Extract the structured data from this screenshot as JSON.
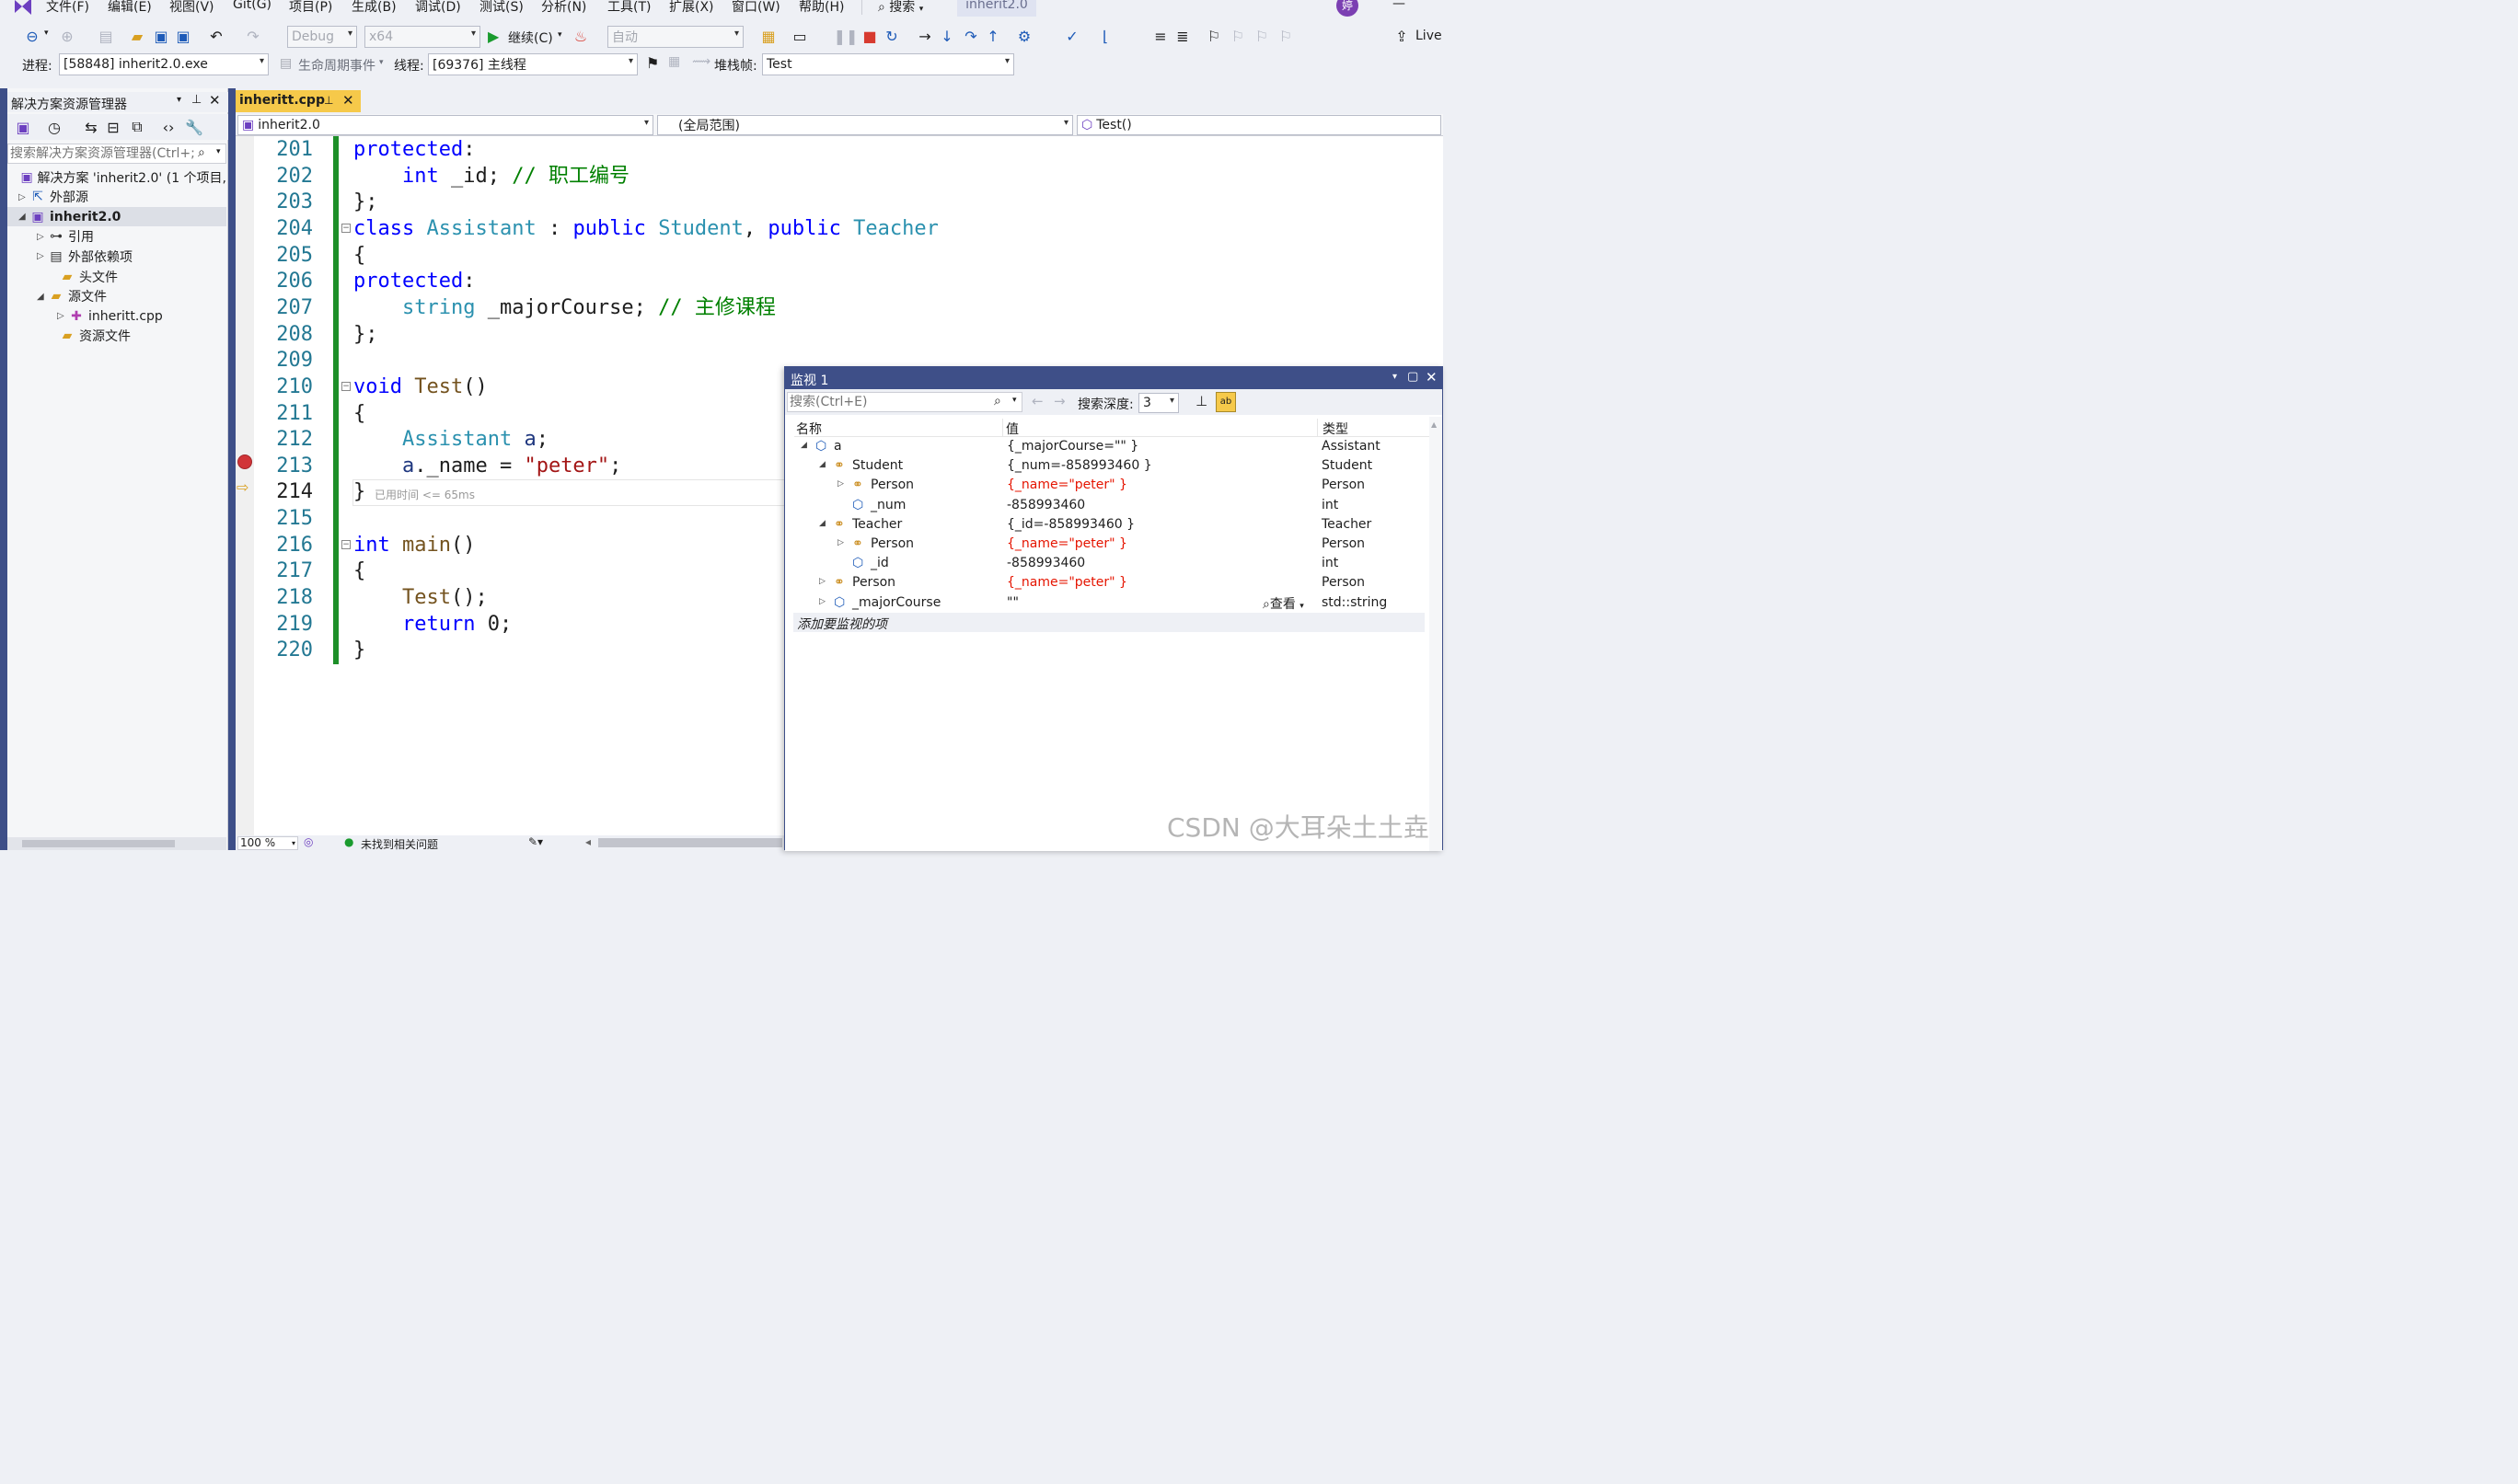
{
  "menu": {
    "items": [
      "文件(F)",
      "编辑(E)",
      "视图(V)",
      "Git(G)",
      "项目(P)",
      "生成(B)",
      "调试(D)",
      "测试(S)",
      "分析(N)",
      "工具(T)",
      "扩展(X)",
      "窗口(W)",
      "帮助(H)"
    ],
    "search": "搜索",
    "solution_tab": "inherit2.0",
    "avatar": "婷"
  },
  "toolbar": {
    "config": "Debug",
    "platform": "x64",
    "continue": "继续(C)",
    "auto": "自动",
    "live": "Live"
  },
  "debugbar": {
    "process_label": "进程:",
    "process": "[58848] inherit2.0.exe",
    "lifecycle": "生命周期事件",
    "thread_label": "线程:",
    "thread": "[69376] 主线程",
    "stack_label": "堆栈帧:",
    "stack": "Test"
  },
  "solution_explorer": {
    "title": "解决方案资源管理器",
    "search_placeholder": "搜索解决方案资源管理器(Ctrl+;)",
    "items": [
      {
        "label": "解决方案 'inherit2.0' (1 个项目,",
        "icon": "solution-icon",
        "tri": ""
      },
      {
        "label": "外部源",
        "icon": "external-source-icon",
        "tri": "▷"
      },
      {
        "label": "inherit2.0",
        "icon": "project-icon",
        "tri": "◢"
      },
      {
        "label": "引用",
        "icon": "references-icon",
        "tri": "▷"
      },
      {
        "label": "外部依赖项",
        "icon": "external-deps-icon",
        "tri": "▷"
      },
      {
        "label": "头文件",
        "icon": "folder-icon",
        "tri": ""
      },
      {
        "label": "源文件",
        "icon": "folder-icon",
        "tri": "◢"
      },
      {
        "label": "inheritt.cpp",
        "icon": "cpp-file-icon",
        "tri": "▷"
      },
      {
        "label": "资源文件",
        "icon": "folder-icon",
        "tri": ""
      }
    ]
  },
  "editor": {
    "tab": "inheritt.cpp",
    "nav_project": "inherit2.0",
    "nav_scope": "(全局范围)",
    "nav_func": "Test()",
    "elapsed": "已用时间 <= 65ms",
    "zoom": "100 %",
    "status": "未找到相关问题",
    "lines": [
      {
        "n": "201",
        "segs": [
          [
            "kw",
            "protected"
          ],
          [
            "pl",
            ":"
          ]
        ]
      },
      {
        "n": "202",
        "segs": [
          [
            "pl",
            "    "
          ],
          [
            "kw",
            "int"
          ],
          [
            "pl",
            " _id; "
          ],
          [
            "cm",
            "// 职工编号"
          ]
        ]
      },
      {
        "n": "203",
        "segs": [
          [
            "pl",
            "};"
          ]
        ]
      },
      {
        "n": "204",
        "segs": [
          [
            "kw",
            "class"
          ],
          [
            "pl",
            " "
          ],
          [
            "ty",
            "Assistant"
          ],
          [
            "pl",
            " : "
          ],
          [
            "kw",
            "public"
          ],
          [
            "pl",
            " "
          ],
          [
            "ty",
            "Student"
          ],
          [
            "pl",
            ", "
          ],
          [
            "kw",
            "public"
          ],
          [
            "pl",
            " "
          ],
          [
            "ty",
            "Teacher"
          ]
        ]
      },
      {
        "n": "205",
        "segs": [
          [
            "pl",
            "{"
          ]
        ]
      },
      {
        "n": "206",
        "segs": [
          [
            "kw",
            "protected"
          ],
          [
            "pl",
            ":"
          ]
        ]
      },
      {
        "n": "207",
        "segs": [
          [
            "pl",
            "    "
          ],
          [
            "ty",
            "string"
          ],
          [
            "pl",
            " _majorCourse; "
          ],
          [
            "cm",
            "// 主修课程"
          ]
        ]
      },
      {
        "n": "208",
        "segs": [
          [
            "pl",
            "};"
          ]
        ]
      },
      {
        "n": "209",
        "segs": []
      },
      {
        "n": "210",
        "segs": [
          [
            "kw",
            "void"
          ],
          [
            "pl",
            " "
          ],
          [
            "fn",
            "Test"
          ],
          [
            "pl",
            "()"
          ]
        ]
      },
      {
        "n": "211",
        "segs": [
          [
            "pl",
            "{"
          ]
        ]
      },
      {
        "n": "212",
        "segs": [
          [
            "pl",
            "    "
          ],
          [
            "ty",
            "Assistant"
          ],
          [
            "pl",
            " "
          ],
          [
            "id",
            "a"
          ],
          [
            "pl",
            ";"
          ]
        ]
      },
      {
        "n": "213",
        "segs": [
          [
            "pl",
            "    "
          ],
          [
            "id",
            "a"
          ],
          [
            "pl",
            "._name = "
          ],
          [
            "st",
            "\"peter\""
          ],
          [
            "pl",
            ";"
          ]
        ]
      },
      {
        "n": "214",
        "segs": [
          [
            "pl",
            "}"
          ]
        ]
      },
      {
        "n": "215",
        "segs": []
      },
      {
        "n": "216",
        "segs": [
          [
            "kw",
            "int"
          ],
          [
            "pl",
            " "
          ],
          [
            "fn",
            "main"
          ],
          [
            "pl",
            "()"
          ]
        ]
      },
      {
        "n": "217",
        "segs": [
          [
            "pl",
            "{"
          ]
        ]
      },
      {
        "n": "218",
        "segs": [
          [
            "pl",
            "    "
          ],
          [
            "fn",
            "Test"
          ],
          [
            "pl",
            "();"
          ]
        ]
      },
      {
        "n": "219",
        "segs": [
          [
            "pl",
            "    "
          ],
          [
            "kw",
            "return"
          ],
          [
            "pl",
            " 0;"
          ]
        ]
      },
      {
        "n": "220",
        "segs": [
          [
            "pl",
            "}"
          ]
        ]
      }
    ]
  },
  "watch": {
    "title": "监视 1",
    "search_placeholder": "搜索(Ctrl+E)",
    "depth_label": "搜索深度:",
    "depth": "3",
    "col_name": "名称",
    "col_value": "值",
    "col_type": "类型",
    "view_label": "查看",
    "add_item": "添加要监视的项",
    "rows": [
      {
        "name": "a",
        "value": "{_majorCourse=\"\" }",
        "type": "Assistant",
        "depth": 0,
        "tri": "◢",
        "icon": "variable-icon",
        "red": false
      },
      {
        "name": "Student",
        "value": "{_num=-858993460 }",
        "type": "Student",
        "depth": 1,
        "tri": "◢",
        "icon": "base-class-icon",
        "red": false
      },
      {
        "name": "Person",
        "value": "{_name=\"peter\" }",
        "type": "Person",
        "depth": 2,
        "tri": "▷",
        "icon": "base-class-icon",
        "red": true
      },
      {
        "name": "_num",
        "value": "-858993460",
        "type": "int",
        "depth": 2,
        "tri": "",
        "icon": "field-icon",
        "red": false
      },
      {
        "name": "Teacher",
        "value": "{_id=-858993460 }",
        "type": "Teacher",
        "depth": 1,
        "tri": "◢",
        "icon": "base-class-icon",
        "red": false
      },
      {
        "name": "Person",
        "value": "{_name=\"peter\" }",
        "type": "Person",
        "depth": 2,
        "tri": "▷",
        "icon": "base-class-icon",
        "red": true
      },
      {
        "name": "_id",
        "value": "-858993460",
        "type": "int",
        "depth": 2,
        "tri": "",
        "icon": "field-icon",
        "red": false
      },
      {
        "name": "Person",
        "value": "{_name=\"peter\" }",
        "type": "Person",
        "depth": 1,
        "tri": "▷",
        "icon": "base-class-icon",
        "red": true
      },
      {
        "name": "_majorCourse",
        "value": "\"\"",
        "type": "std::string",
        "depth": 1,
        "tri": "▷",
        "icon": "field-icon",
        "red": false
      }
    ]
  },
  "watermark": "CSDN @大耳朵土土垚"
}
